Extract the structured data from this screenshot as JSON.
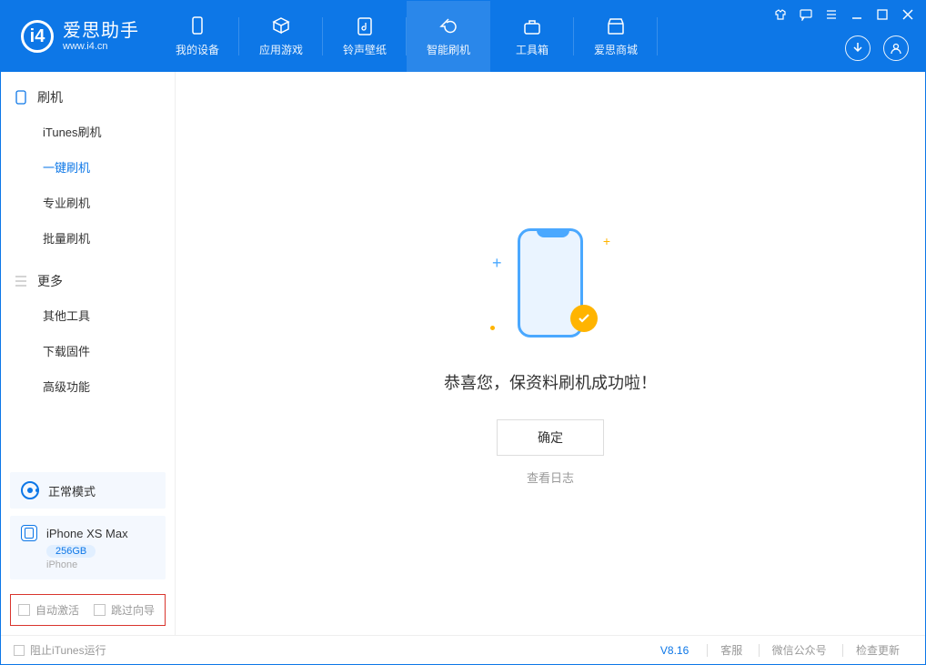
{
  "app": {
    "name_cn": "爱思助手",
    "name_en": "www.i4.cn"
  },
  "nav": {
    "items": [
      {
        "label": "我的设备",
        "icon": "device"
      },
      {
        "label": "应用游戏",
        "icon": "cube"
      },
      {
        "label": "铃声壁纸",
        "icon": "music"
      },
      {
        "label": "智能刷机",
        "icon": "refresh",
        "selected": true
      },
      {
        "label": "工具箱",
        "icon": "toolbox"
      },
      {
        "label": "爱思商城",
        "icon": "store"
      }
    ]
  },
  "sidebar": {
    "group1": {
      "title": "刷机",
      "items": [
        {
          "label": "iTunes刷机"
        },
        {
          "label": "一键刷机",
          "selected": true
        },
        {
          "label": "专业刷机"
        },
        {
          "label": "批量刷机"
        }
      ]
    },
    "group2": {
      "title": "更多",
      "items": [
        {
          "label": "其他工具"
        },
        {
          "label": "下载固件"
        },
        {
          "label": "高级功能"
        }
      ]
    },
    "mode_label": "正常模式",
    "device": {
      "name": "iPhone XS Max",
      "storage": "256GB",
      "type": "iPhone"
    },
    "checkbox_auto": "自动激活",
    "checkbox_skip": "跳过向导"
  },
  "main": {
    "success_message": "恭喜您，保资料刷机成功啦！",
    "ok_button": "确定",
    "view_log": "查看日志"
  },
  "footer": {
    "stop_itunes": "阻止iTunes运行",
    "version": "V8.16",
    "link_service": "客服",
    "link_wechat": "微信公众号",
    "link_update": "检查更新"
  }
}
